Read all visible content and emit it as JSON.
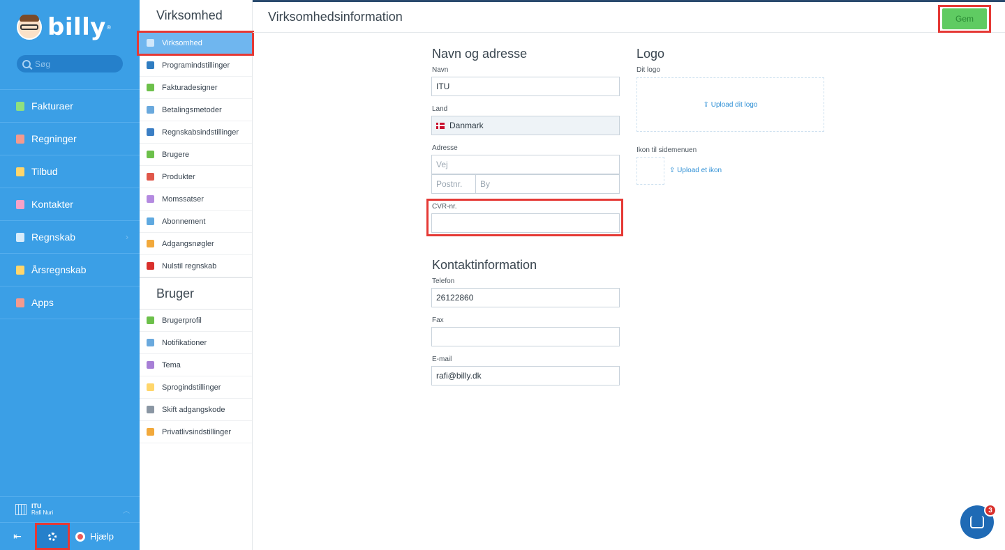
{
  "brand": {
    "name": "billy",
    "mark": "®"
  },
  "search": {
    "placeholder": "Søg"
  },
  "nav": {
    "items": [
      {
        "label": "Fakturaer",
        "icon": "invoice-icon",
        "color": "#8fe07e"
      },
      {
        "label": "Regninger",
        "icon": "bill-icon",
        "color": "#f49a8e"
      },
      {
        "label": "Tilbud",
        "icon": "star-icon",
        "color": "#ffd66b"
      },
      {
        "label": "Kontakter",
        "icon": "contact-icon",
        "color": "#f7a2c8"
      },
      {
        "label": "Regnskab",
        "icon": "ledger-icon",
        "color": "#d8ecfb",
        "chevron": "›"
      },
      {
        "label": "Årsregnskab",
        "icon": "annual-report-icon",
        "color": "#ffd66b"
      },
      {
        "label": "Apps",
        "icon": "apps-icon",
        "color": "#f49a8e"
      }
    ]
  },
  "org": {
    "name": "ITU",
    "user": "Rafi Nuri",
    "chevron": "︿"
  },
  "bottom": {
    "logout_glyph": "⇤",
    "help_label": "Hjælp"
  },
  "subnav": {
    "company_heading": "Virksomhed",
    "company_items": [
      {
        "label": "Virksomhed",
        "icon": "company-icon",
        "color": "#cfe7fb"
      },
      {
        "label": "Programindstillinger",
        "icon": "gear-icon",
        "color": "#2f7dc1"
      },
      {
        "label": "Fakturadesigner",
        "icon": "brush-icon",
        "color": "#6cc04a"
      },
      {
        "label": "Betalingsmetoder",
        "icon": "card-icon",
        "color": "#6aa9dd"
      },
      {
        "label": "Regnskabsindstillinger",
        "icon": "books-icon",
        "color": "#3b7ec4"
      },
      {
        "label": "Brugere",
        "icon": "users-icon",
        "color": "#6cc04a"
      },
      {
        "label": "Produkter",
        "icon": "products-icon",
        "color": "#e0574a"
      },
      {
        "label": "Momssatser",
        "icon": "pie-icon",
        "color": "#b48ae0"
      },
      {
        "label": "Abonnement",
        "icon": "puzzle-icon",
        "color": "#5fa9e0"
      },
      {
        "label": "Adgangsnøgler",
        "icon": "key-icon",
        "color": "#f2a93b"
      },
      {
        "label": "Nulstil regnskab",
        "icon": "warning-icon",
        "color": "#d9302c"
      }
    ],
    "user_heading": "Bruger",
    "user_items": [
      {
        "label": "Brugerprofil",
        "icon": "user-profile-icon",
        "color": "#6cc04a"
      },
      {
        "label": "Notifikationer",
        "icon": "notification-icon",
        "color": "#6aa9dd"
      },
      {
        "label": "Tema",
        "icon": "theme-icon",
        "color": "#a77fd6"
      },
      {
        "label": "Sprogindstillinger",
        "icon": "speech-icon",
        "color": "#ffd66b"
      },
      {
        "label": "Skift adgangskode",
        "icon": "lock-icon",
        "color": "#8a96a3"
      },
      {
        "label": "Privatlivsindstillinger",
        "icon": "privacy-icon",
        "color": "#f2a93b"
      }
    ]
  },
  "header": {
    "title": "Virksomhedsinformation",
    "save_label": "Gem"
  },
  "form": {
    "name_section": "Navn og adresse",
    "name_label": "Navn",
    "name_value": "ITU",
    "country_label": "Land",
    "country_value": "Danmark",
    "address_label": "Adresse",
    "street_placeholder": "Vej",
    "zip_placeholder": "Postnr.",
    "city_placeholder": "By",
    "cvr_label": "CVR-nr.",
    "cvr_value": "",
    "contact_section": "Kontaktinformation",
    "phone_label": "Telefon",
    "phone_value": "26122860",
    "fax_label": "Fax",
    "fax_value": "",
    "email_label": "E-mail",
    "email_value": "rafi@billy.dk"
  },
  "logo": {
    "section": "Logo",
    "logo_label": "Dit logo",
    "upload_logo": "Upload dit logo",
    "icon_label": "Ikon til sidemenuen",
    "upload_icon": "Upload et ikon"
  },
  "chat": {
    "badge": "3"
  },
  "colors": {
    "sidebar": "#3b9fe6",
    "accent": "#6fb6ef",
    "save": "#5fcb62",
    "highlight": "#e53935"
  }
}
